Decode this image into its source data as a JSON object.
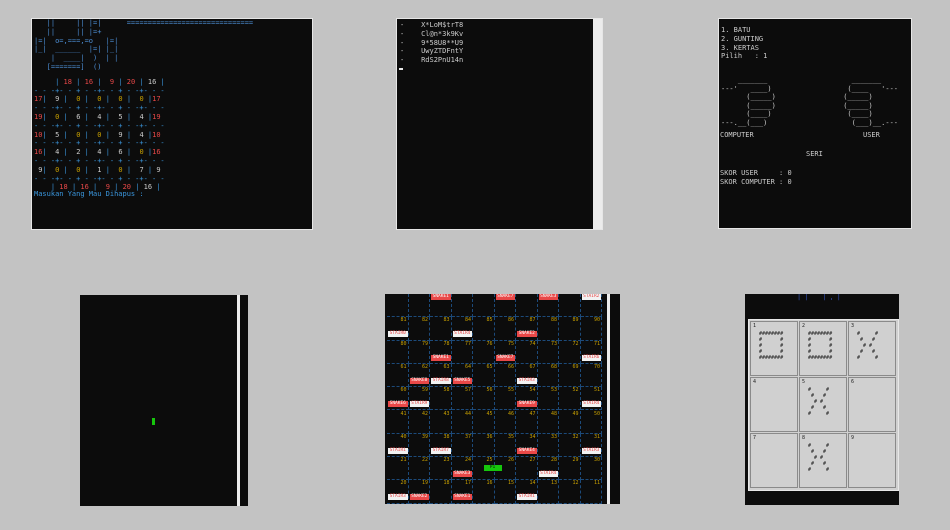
{
  "windows": {
    "sudoku": {
      "art_lines": [
        "   ||     || |=|      ==============================",
        "   ||     || |=+",
        "|=|  o=,===,=o   |=|",
        "|_|  ______  |=| |_|",
        "    |  ____|  )  | |",
        "   [=======]  ()"
      ],
      "grid_rows": [
        "    | 18 | 16 | 9 | 20 | 16 |",
        "-----+----+----+----+----+----+----",
        "17 | 9 | 0 | 0 | 0 | 0 |17",
        "-----+----+----+----+----+----+----",
        "19 | 0 | 6 | 4 | 5 | 4 |19",
        "-----+----+----+----+----+----+----",
        "10 | 5 | 0 | 0 | 9 | 4 |10",
        "-----+----+----+----+----+----+----",
        "16 | 4 | 2 | 4 | 6 | 0 |16",
        "-----+----+----+----+----+----+----",
        " 9 | 0 | 0 | 1 | 0 | 7 | 9",
        "-----+----+----+----+----+----+----",
        "    | 18 | 16 | 9 | 20 | 16 |"
      ],
      "prompt": "Masukan Yang Mau Dihapus :"
    },
    "passwords": {
      "items": [
        "X*LoM$trT8",
        "Cl@n*3k9Kv",
        "9*58U8**U9",
        "UwyZTDFntY",
        "RdS2PnU14n"
      ],
      "bullet": "-"
    },
    "suit": {
      "menu": [
        "1. BATU",
        "2. GUNTING",
        "3. KERTAS"
      ],
      "pilih_label": "Pilih",
      "pilih_value": "1",
      "left_label": "COMPUTER",
      "right_label": "USER",
      "result": "SERI",
      "skor_user_label": "SKOR USER",
      "skor_user": "0",
      "skor_comp_label": "SKOR COMPUTER",
      "skor_comp": "0"
    },
    "snake_game": {
      "food_color": "#16c60c"
    },
    "ular_tangga": {
      "rows": [
        [
          100,
          99,
          98,
          97,
          96,
          95,
          94,
          93,
          92,
          91
        ],
        [
          81,
          82,
          83,
          84,
          85,
          86,
          87,
          88,
          89,
          90
        ],
        [
          80,
          79,
          78,
          77,
          76,
          75,
          74,
          73,
          72,
          71
        ],
        [
          61,
          62,
          63,
          64,
          65,
          66,
          67,
          68,
          69,
          70
        ],
        [
          60,
          59,
          58,
          57,
          56,
          55,
          54,
          53,
          52,
          51
        ],
        [
          41,
          42,
          43,
          44,
          45,
          46,
          47,
          48,
          49,
          50
        ],
        [
          40,
          39,
          38,
          37,
          36,
          35,
          34,
          33,
          32,
          31
        ],
        [
          21,
          22,
          23,
          24,
          25,
          26,
          27,
          28,
          29,
          30
        ],
        [
          20,
          19,
          18,
          17,
          16,
          15,
          14,
          13,
          12,
          11
        ]
      ],
      "snake_label": "SNAKE",
      "stair_label": "STAIR",
      "player_label": "P1"
    },
    "tictactoe": {
      "cells": [
        {
          "n": "1",
          "mark": "########\n#      #\n#      #\n#      #\n########"
        },
        {
          "n": "2",
          "mark": "########\n#      #\n#      #\n#      #\n########"
        },
        {
          "n": "3",
          "mark": "#     #\n #   #\n  # #\n #   #\n#     #"
        },
        {
          "n": "4",
          "mark": ""
        },
        {
          "n": "5",
          "mark": "#     #\n #   #\n  # #\n #   #\n#     #"
        },
        {
          "n": "6",
          "mark": ""
        },
        {
          "n": "7",
          "mark": ""
        },
        {
          "n": "8",
          "mark": "#     #\n #   #\n  # #\n #   #\n#     #"
        },
        {
          "n": "9",
          "mark": ""
        }
      ]
    }
  }
}
